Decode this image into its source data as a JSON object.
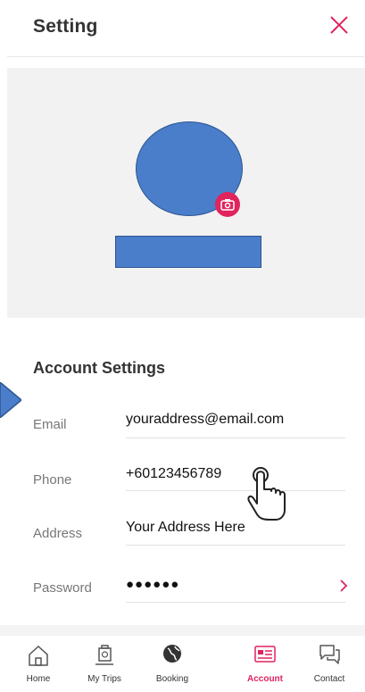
{
  "header": {
    "title": "Setting",
    "close_icon": "close-x-icon"
  },
  "profile": {
    "camera_icon": "camera-icon"
  },
  "account_settings": {
    "title": "Account Settings",
    "fields": [
      {
        "label": "Email",
        "value": "youraddress@email.com"
      },
      {
        "label": "Phone",
        "value": "+60123456789"
      },
      {
        "label": "Address",
        "value": "Your Address Here"
      },
      {
        "label": "Password",
        "value": "●●●●●●"
      }
    ]
  },
  "bottom_nav": {
    "items": [
      {
        "label": "Home",
        "icon": "home-icon"
      },
      {
        "label": "My Trips",
        "icon": "suitcase-icon"
      },
      {
        "label": "Booking",
        "icon": "globe-icon"
      },
      {
        "label": "Account",
        "icon": "account-card-icon",
        "active": true
      },
      {
        "label": "Contact",
        "icon": "chat-bubbles-icon"
      }
    ]
  },
  "colors": {
    "accent": "#e0245e",
    "placeholder_blue": "#4a7ecb",
    "panel": "#f2f2f2"
  }
}
